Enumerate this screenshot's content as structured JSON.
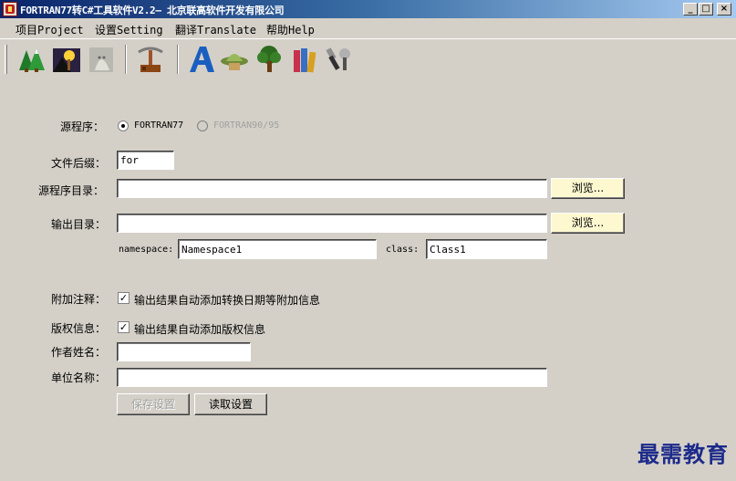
{
  "window": {
    "title": "FORTRAN77转C#工具软件V2.2— 北京联高软件开发有限公司",
    "minimize_label": "_",
    "maximize_label": "□",
    "close_label": "×"
  },
  "menu": {
    "items": [
      {
        "label": "项目Project"
      },
      {
        "label": "设置Setting"
      },
      {
        "label": "翻译Translate"
      },
      {
        "label": "帮助Help"
      }
    ]
  },
  "toolbar": {
    "icons": [
      "forest-icon",
      "torch-night-icon",
      "ghost-icon",
      "pickaxe-icon",
      "letter-a-icon",
      "hat-icon",
      "tree-icon",
      "books-icon",
      "tools-icon"
    ]
  },
  "form": {
    "source_label": "源程序：",
    "source_options": [
      {
        "label": "FORTRAN77",
        "checked": true,
        "disabled": false
      },
      {
        "label": "FORTRAN90/95",
        "checked": false,
        "disabled": true
      }
    ],
    "ext_label": "文件后缀：",
    "ext_value": "for",
    "srcdir_label": "源程序目录：",
    "srcdir_value": "",
    "browse_label": "浏览...",
    "outdir_label": "输出目录：",
    "outdir_value": "",
    "namespace_label": "namespace:",
    "namespace_value": "Namespace1",
    "class_label": "class:",
    "class_value": "Class1",
    "note_label": "附加注释：",
    "note_check_label": "输出结果自动添加转换日期等附加信息",
    "note_checked": true,
    "copyright_label": "版权信息：",
    "copyright_check_label": "输出结果自动添加版权信息",
    "copyright_checked": true,
    "author_label": "作者姓名：",
    "author_value": "",
    "org_label": "单位名称：",
    "org_value": "",
    "save_label": "保存设置",
    "load_label": "读取设置"
  },
  "watermark": "最需教育",
  "colors": {
    "face": "#d4d0c8",
    "title_start": "#0a246a",
    "title_end": "#a6caf0",
    "browse_bg": "#fdf8d0"
  }
}
